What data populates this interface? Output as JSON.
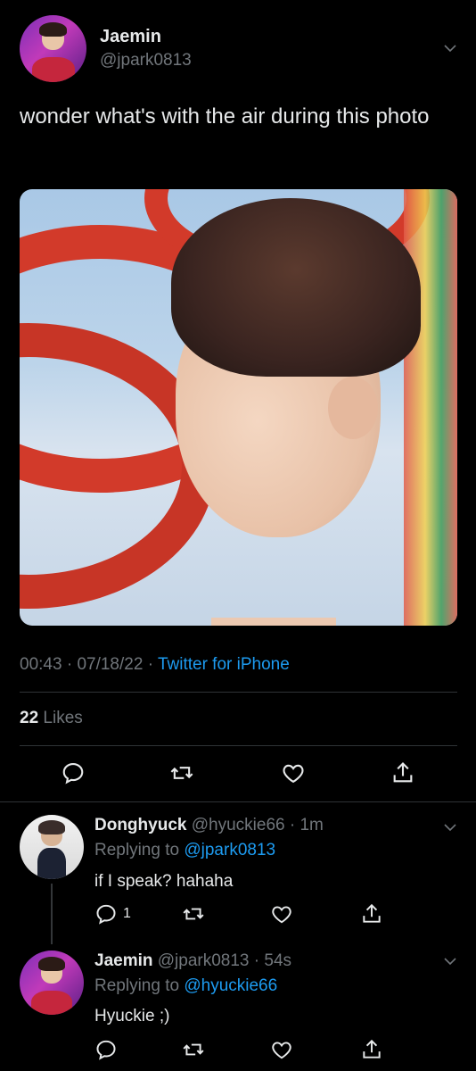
{
  "tweet": {
    "author_name": "Jaemin",
    "author_handle": "@jpark0813",
    "text": "wonder what's with the air during this photo",
    "time": "00:43",
    "date": "07/18/22",
    "source": "Twitter for iPhone",
    "likes_count": "22",
    "likes_label": "Likes"
  },
  "replies": [
    {
      "name": "Donghyuck",
      "handle": "@hyuckie66",
      "time": "1m",
      "replying_prefix": "Replying to",
      "replying_to": "@jpark0813",
      "text": "if I speak? hahaha",
      "reply_count": "1"
    },
    {
      "name": "Jaemin",
      "handle": "@jpark0813",
      "time": "54s",
      "replying_prefix": "Replying to",
      "replying_to": "@hyuckie66",
      "text": "Hyuckie ;)",
      "reply_count": ""
    }
  ],
  "icons": {
    "reply": "reply-icon",
    "retweet": "retweet-icon",
    "like": "heart-icon",
    "share": "share-icon",
    "more": "chevron-down-icon"
  },
  "colors": {
    "background": "#000000",
    "text": "#e7e9ea",
    "muted": "#71767b",
    "link": "#1d9bf0",
    "divider": "#2f3336"
  }
}
